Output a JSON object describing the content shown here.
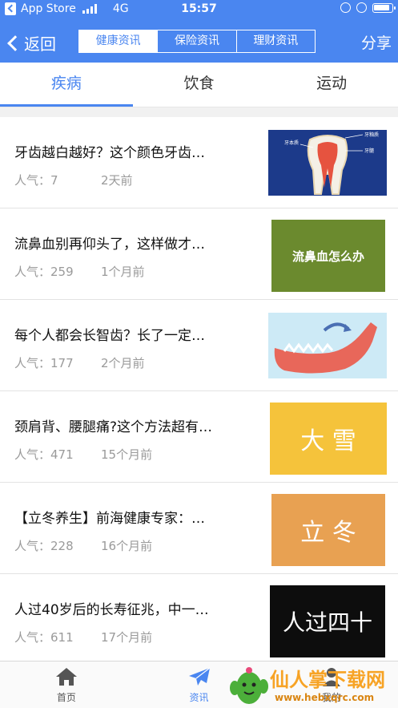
{
  "status_bar": {
    "carrier": "App Store",
    "network": "4G",
    "time": "15:57"
  },
  "nav": {
    "back_label": "返回",
    "share_label": "分享",
    "segments": [
      "健康资讯",
      "保险资讯",
      "理财资讯"
    ],
    "active_segment": 0
  },
  "categories": {
    "tabs": [
      "疾病",
      "饮食",
      "运动"
    ],
    "active": 0
  },
  "articles": [
    {
      "title": "牙齿越白越好？这个颜色牙齿…",
      "popularity": "人气：7",
      "time": "2天前",
      "thumb_type": "tooth-diagram",
      "thumb_labels": [
        "牙本质",
        "牙釉质",
        "牙髓"
      ]
    },
    {
      "title": "流鼻血别再仰头了，这样做才…",
      "popularity": "人气：259",
      "time": "1个月前",
      "thumb_type": "text",
      "thumb_text": "流鼻血怎么办",
      "thumb_bg": "#6b8a2e"
    },
    {
      "title": "每个人都会长智齿？长了一定…",
      "popularity": "人气：177",
      "time": "2个月前",
      "thumb_type": "jaw-diagram"
    },
    {
      "title": "颈肩背、腰腿痛?这个方法超有…",
      "popularity": "人气：471",
      "time": "15个月前",
      "thumb_type": "text",
      "thumb_text": "大 雪",
      "thumb_bg": "#f5c33b"
    },
    {
      "title": "【立冬养生】前海健康专家：…",
      "popularity": "人气：228",
      "time": "16个月前",
      "thumb_type": "text",
      "thumb_text": "立 冬",
      "thumb_bg": "#e8a152"
    },
    {
      "title": "人过40岁后的长寿征兆，中一…",
      "popularity": "人气：611",
      "time": "17个月前",
      "thumb_type": "text",
      "thumb_text": "人过四十",
      "thumb_bg": "#111111"
    }
  ],
  "tab_bar": {
    "items": [
      {
        "label": "首页",
        "icon": "home-icon"
      },
      {
        "label": "资讯",
        "icon": "paper-plane-icon"
      },
      {
        "label": "我的",
        "icon": "profile-icon"
      }
    ],
    "active": 1
  },
  "watermark": {
    "text": "仙人掌下载网",
    "url": "www.hebxqrc.com"
  },
  "colors": {
    "accent": "#4a86f0"
  }
}
